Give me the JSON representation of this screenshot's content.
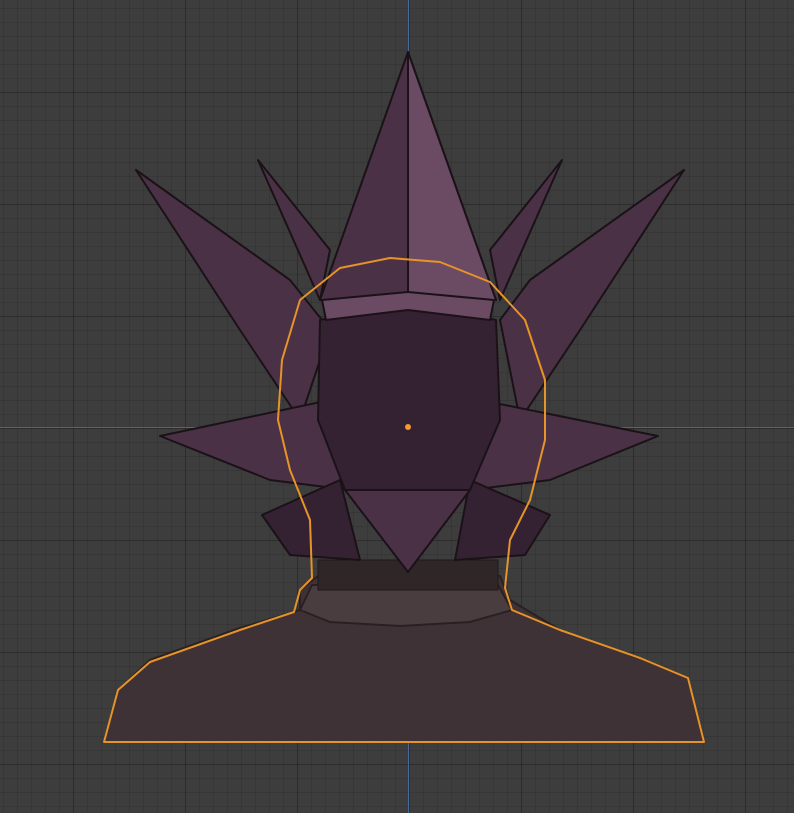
{
  "viewport": {
    "background_color": "#3d3d3d",
    "grid_color": "#2e2e2e",
    "x_axis_color": "#a3454b",
    "y_axis_color": "#4a6a9a",
    "selection_outline_color": "#e6932a",
    "origin_dot_color": "#f29a2e"
  },
  "model": {
    "hair_color": "#4a3145",
    "hair_shadow_color": "#342232",
    "hair_highlight_color": "#6b4a63",
    "body_color": "#3f3236",
    "collar_color": "#4a3d3f"
  }
}
